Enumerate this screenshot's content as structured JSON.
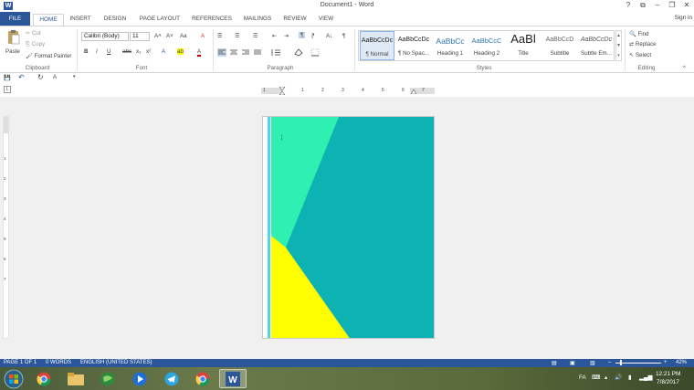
{
  "window": {
    "title": "Document1 - Word",
    "app_logo": "W",
    "help": "?",
    "ribbon_display": "⧉",
    "minimize": "–",
    "restore": "❐",
    "close": "✕",
    "sign_in": "Sign in"
  },
  "tabs": [
    "FILE",
    "HOME",
    "INSERT",
    "DESIGN",
    "PAGE LAYOUT",
    "REFERENCES",
    "MAILINGS",
    "REVIEW",
    "VIEW"
  ],
  "clipboard": {
    "paste": "Paste",
    "cut": "Cut",
    "copy": "Copy",
    "format_painter": "Format Painter",
    "label": "Clipboard"
  },
  "font": {
    "name": "Calibri (Body)",
    "size": "11",
    "grow": "A˄",
    "shrink": "A˅",
    "case": "Aa",
    "clear": "A",
    "bold": "B",
    "italic": "I",
    "underline": "U",
    "strike": "abc",
    "subscript": "x₂",
    "superscript": "x²",
    "effects": "A",
    "highlight": "ab",
    "color": "A",
    "label": "Font"
  },
  "paragraph": {
    "bullets": "☰",
    "numbering": "☰",
    "multilevel": "☰",
    "decrease_indent": "⇤",
    "increase_indent": "⇥",
    "ltr": "¶",
    "rtl": "¶",
    "sort": "A↓",
    "show_marks": "¶",
    "label": "Paragraph"
  },
  "styles": {
    "items": [
      {
        "preview": "AaBbCcDc",
        "name": "¶ Normal"
      },
      {
        "preview": "AaBbCcDc",
        "name": "¶ No Spac..."
      },
      {
        "preview": "AaBbCc",
        "name": "Heading 1"
      },
      {
        "preview": "AaBbCcC",
        "name": "Heading 2"
      },
      {
        "preview": "AaBl",
        "name": "Title"
      },
      {
        "preview": "AaBbCcD",
        "name": "Subtitle"
      },
      {
        "preview": "AaBbCcDc",
        "name": "Subtle Em..."
      }
    ],
    "label": "Styles"
  },
  "editing": {
    "find": "Find",
    "replace": "Replace",
    "select": "Select",
    "label": "Editing"
  },
  "qat": {
    "save": "💾",
    "undo": "↶",
    "redo": "↻",
    "font_color": "A"
  },
  "ruler": {
    "ticks": [
      "1",
      "1",
      "2",
      "3",
      "4",
      "5",
      "6",
      "7"
    ],
    "vticks": [
      "1",
      "2",
      "3",
      "4",
      "5",
      "6",
      "7"
    ]
  },
  "page": {
    "colors": {
      "teal": "#0db3b3",
      "mint": "#2ef0b0",
      "yellow": "#ffff00",
      "stripe": "#4fd5f0"
    },
    "cursor_text": "¦"
  },
  "status": {
    "page": "PAGE 1 OF 1",
    "words": "0 WORDS",
    "language": "ENGLISH (UNITED STATES)",
    "zoom": "42%",
    "zoom_minus": "–",
    "zoom_plus": "+"
  },
  "taskbar": {
    "lang": "FA",
    "time": "12:21 PM",
    "date": "7/8/2017"
  }
}
